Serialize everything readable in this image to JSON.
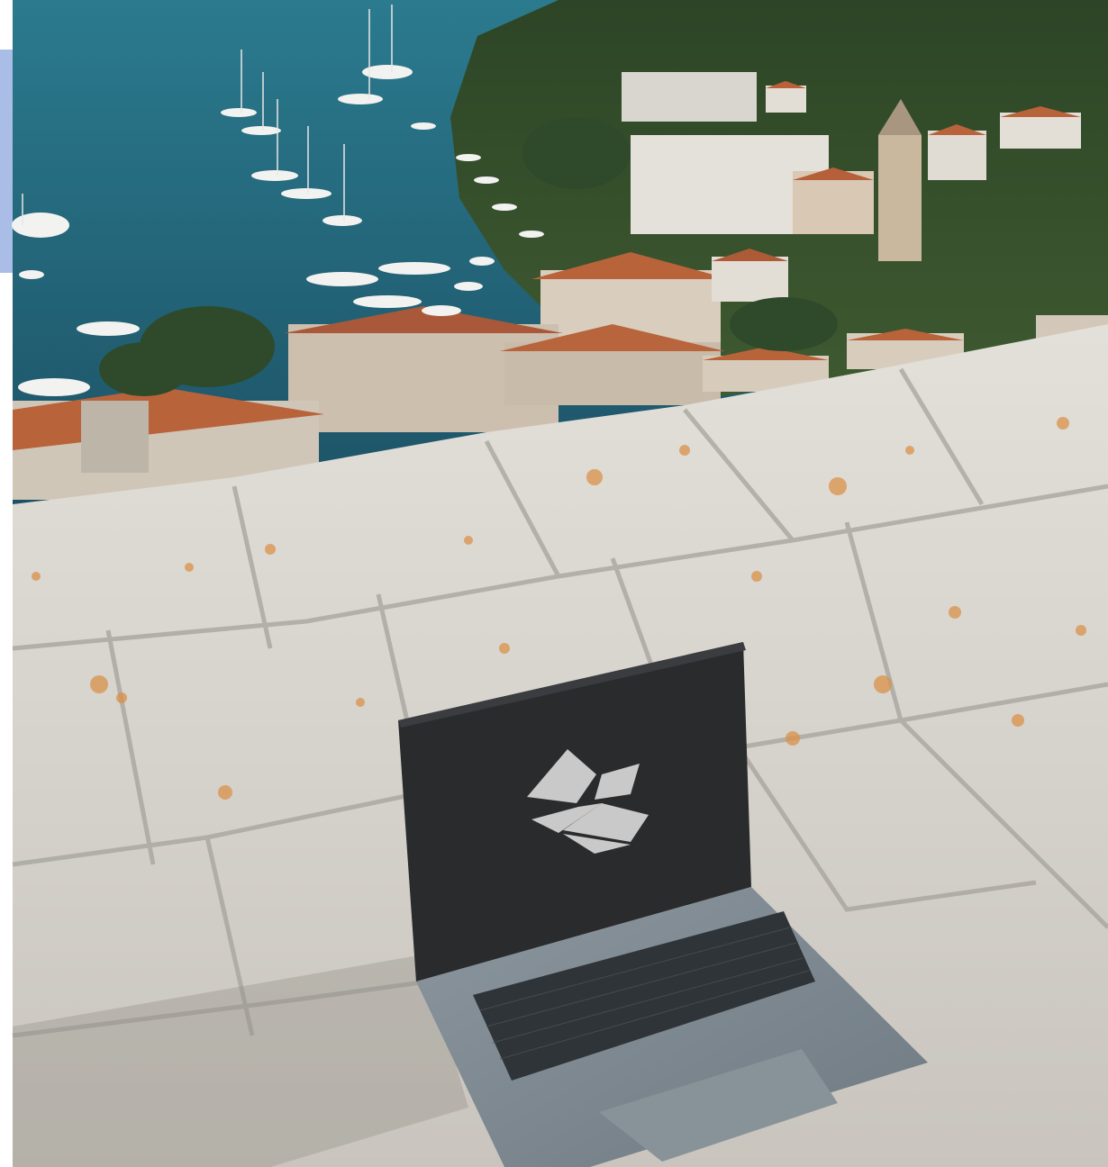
{
  "colors": {
    "sea": "#1f5f74",
    "sea_light": "#3a8aa0",
    "stone": "#d8d4cd",
    "stone_shadow": "#a6a39c",
    "lichen": "#d9914a",
    "roof": "#b9633a",
    "vegetation": "#2f4a2a",
    "laptop_body": "#7f8a92",
    "laptop_screen": "#2a2b2d",
    "logo": "#c9c9c9",
    "side_accent": "#a9bde6"
  },
  "icons": {
    "screen_logo": "cube-logo-icon"
  }
}
